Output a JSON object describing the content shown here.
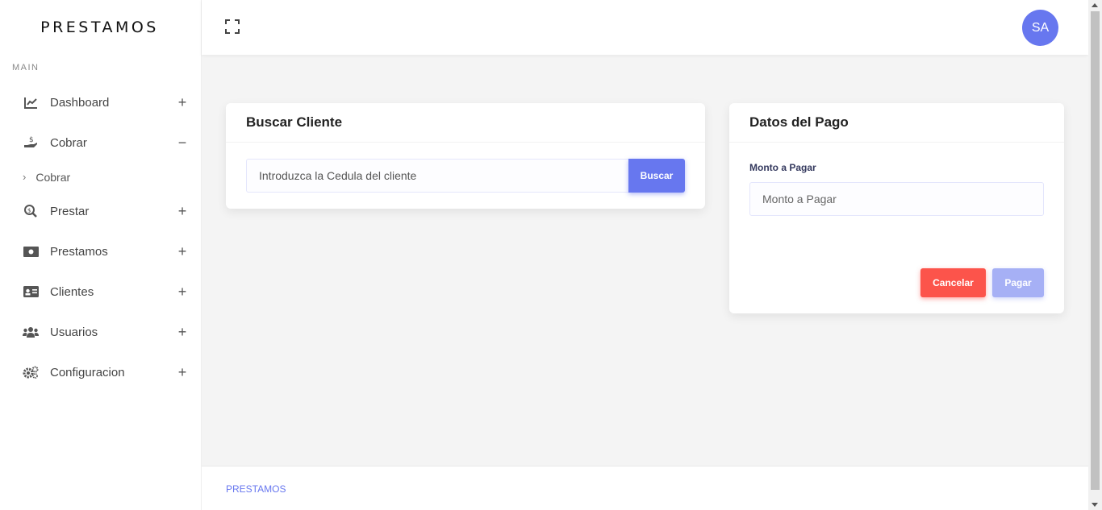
{
  "brand": "PRESTAMOS",
  "sidebar": {
    "section_title": "MAIN",
    "items": [
      {
        "label": "Dashboard",
        "toggle": "+",
        "icon": "chart-line-icon"
      },
      {
        "label": "Cobrar",
        "toggle": "−",
        "icon": "hand-holding-usd-icon"
      },
      {
        "label": "Prestar",
        "toggle": "+",
        "icon": "search-dollar-icon"
      },
      {
        "label": "Prestamos",
        "toggle": "+",
        "icon": "money-bill-icon"
      },
      {
        "label": "Clientes",
        "toggle": "+",
        "icon": "id-card-icon"
      },
      {
        "label": "Usuarios",
        "toggle": "+",
        "icon": "users-icon"
      },
      {
        "label": "Configuracion",
        "toggle": "+",
        "icon": "cogs-icon"
      }
    ],
    "sub_item": {
      "label": "Cobrar",
      "chevron": "›"
    }
  },
  "topbar": {
    "avatar_initials": "SA"
  },
  "buscar_card": {
    "title": "Buscar Cliente",
    "search_placeholder": "Introduzca la Cedula del cliente",
    "button_label": "Buscar"
  },
  "pago_card": {
    "title": "Datos del Pago",
    "monto_label": "Monto a Pagar",
    "monto_placeholder": "Monto a Pagar",
    "cancel_label": "Cancelar",
    "pay_label": "Pagar"
  },
  "footer": {
    "text": "PRESTAMOS"
  },
  "colors": {
    "primary": "#6777ef",
    "danger": "#fc544b",
    "primary_disabled": "#a6b0f5"
  }
}
